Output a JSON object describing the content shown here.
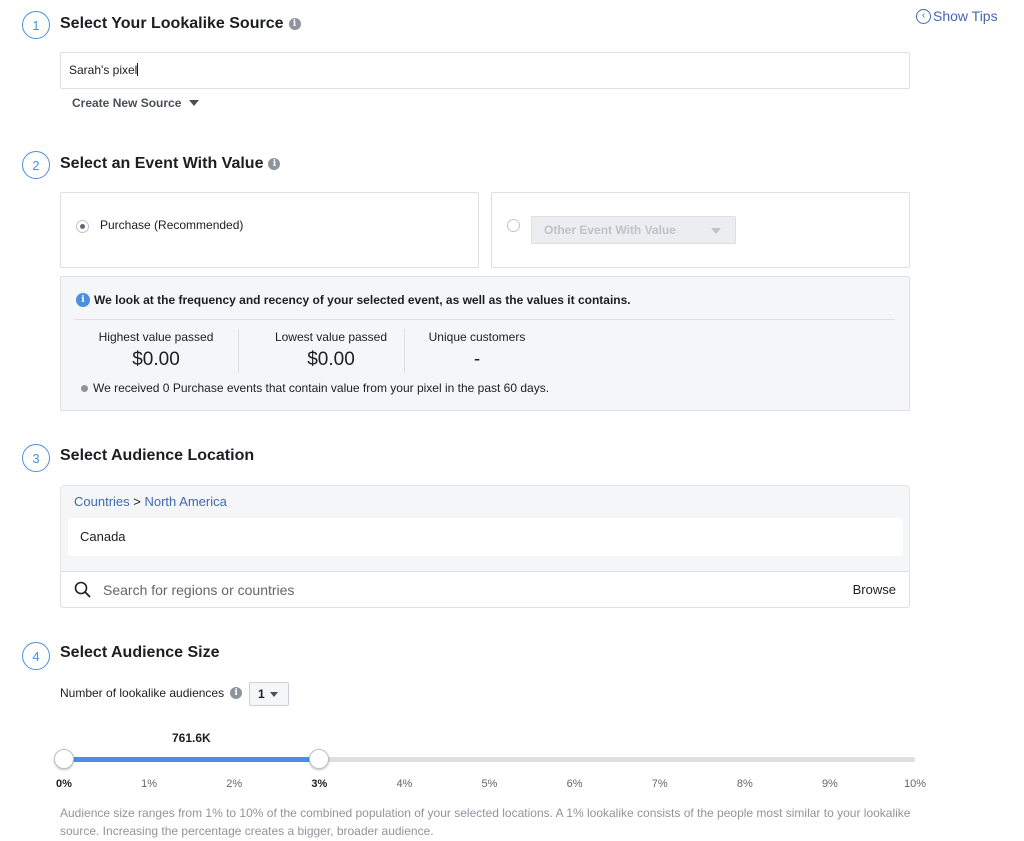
{
  "show_tips": "Show Tips",
  "steps": [
    {
      "number": "1",
      "title": "Select Your Lookalike Source"
    },
    {
      "number": "2",
      "title": "Select an Event With Value"
    },
    {
      "number": "3",
      "title": "Select Audience Location"
    },
    {
      "number": "4",
      "title": "Select Audience Size"
    }
  ],
  "source": {
    "value": "Sarah's pixel",
    "create_new_label": "Create New Source"
  },
  "event": {
    "option_purchase": "Purchase (Recommended)",
    "option_other_select": "Other Event With Value",
    "selected": "purchase",
    "info_text": "We look at the frequency and recency of your selected event, as well as the values it contains.",
    "stats": [
      {
        "label": "Highest value passed",
        "value": "$0.00"
      },
      {
        "label": "Lowest value passed",
        "value": "$0.00"
      },
      {
        "label": "Unique customers",
        "value": "-"
      }
    ],
    "note": "We received 0 Purchase events that contain value from your pixel in the past 60 days."
  },
  "location": {
    "breadcrumb_root": "Countries",
    "breadcrumb_separator": ">",
    "breadcrumb_current": "North America",
    "selected_item": "Canada",
    "search_placeholder": "Search for regions or countries",
    "browse_label": "Browse"
  },
  "size": {
    "num_audiences_label": "Number of lookalike audiences",
    "num_audiences_value": "1",
    "slider_reach": "761.6K",
    "slider_start_percent": 0,
    "slider_end_percent": 3,
    "ticks": [
      "0%",
      "1%",
      "2%",
      "3%",
      "4%",
      "5%",
      "6%",
      "7%",
      "8%",
      "9%",
      "10%"
    ],
    "footnote": "Audience size ranges from 1% to 10% of the combined population of your selected locations. A 1% lookalike consists of the people most similar to your lookalike source. Increasing the percentage creates a bigger, broader audience."
  },
  "colors": {
    "accent": "#4a90e2",
    "link": "#4267b2",
    "panel_bg": "#f5f6f7"
  }
}
